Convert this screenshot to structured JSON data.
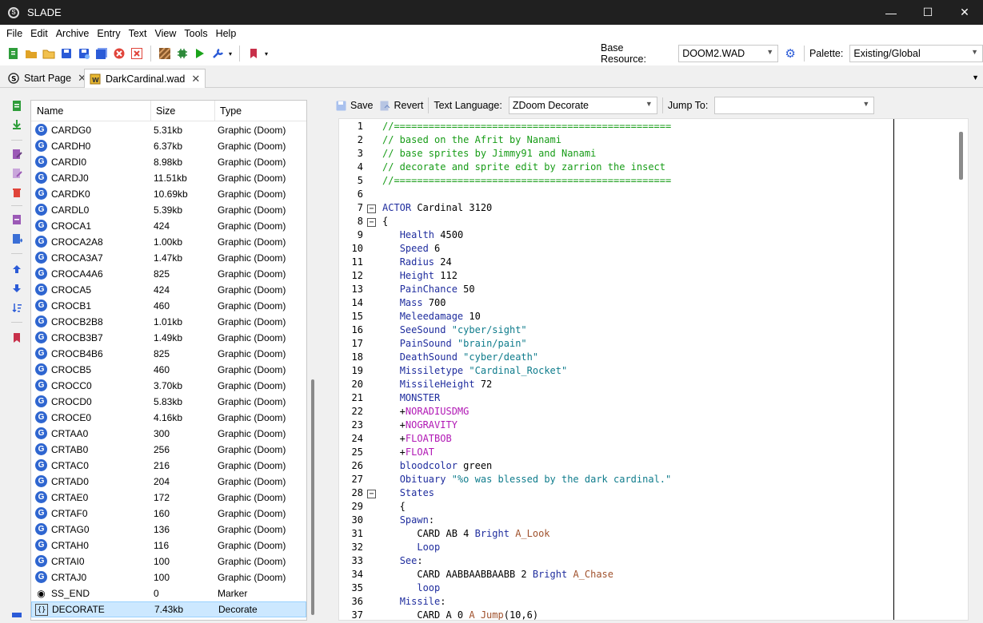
{
  "window": {
    "title": "SLADE",
    "minimize": "—",
    "maximize": "☐",
    "close": "✕"
  },
  "menu": [
    "File",
    "Edit",
    "Archive",
    "Entry",
    "Text",
    "View",
    "Tools",
    "Help"
  ],
  "toolbar": {
    "base_resource_label": "Base Resource:",
    "base_resource_value": "DOOM2.WAD",
    "palette_label": "Palette:",
    "palette_value": "Existing/Global"
  },
  "tabs": [
    {
      "label": "Start Page",
      "close": "✕"
    },
    {
      "label": "DarkCardinal.wad",
      "close": "✕"
    }
  ],
  "entry_list": {
    "columns": [
      "Name",
      "Size",
      "Type"
    ],
    "rows": [
      {
        "name": "CARDG0",
        "size": "5.31kb",
        "type": "Graphic (Doom)",
        "icon": "graphic-icon"
      },
      {
        "name": "CARDH0",
        "size": "6.37kb",
        "type": "Graphic (Doom)",
        "icon": "graphic-icon"
      },
      {
        "name": "CARDI0",
        "size": "8.98kb",
        "type": "Graphic (Doom)",
        "icon": "graphic-icon"
      },
      {
        "name": "CARDJ0",
        "size": "11.51kb",
        "type": "Graphic (Doom)",
        "icon": "graphic-icon"
      },
      {
        "name": "CARDK0",
        "size": "10.69kb",
        "type": "Graphic (Doom)",
        "icon": "graphic-icon"
      },
      {
        "name": "CARDL0",
        "size": "5.39kb",
        "type": "Graphic (Doom)",
        "icon": "graphic-icon"
      },
      {
        "name": "CROCA1",
        "size": "424",
        "type": "Graphic (Doom)",
        "icon": "graphic-icon"
      },
      {
        "name": "CROCA2A8",
        "size": "1.00kb",
        "type": "Graphic (Doom)",
        "icon": "graphic-icon"
      },
      {
        "name": "CROCA3A7",
        "size": "1.47kb",
        "type": "Graphic (Doom)",
        "icon": "graphic-icon"
      },
      {
        "name": "CROCA4A6",
        "size": "825",
        "type": "Graphic (Doom)",
        "icon": "graphic-icon"
      },
      {
        "name": "CROCA5",
        "size": "424",
        "type": "Graphic (Doom)",
        "icon": "graphic-icon"
      },
      {
        "name": "CROCB1",
        "size": "460",
        "type": "Graphic (Doom)",
        "icon": "graphic-icon"
      },
      {
        "name": "CROCB2B8",
        "size": "1.01kb",
        "type": "Graphic (Doom)",
        "icon": "graphic-icon"
      },
      {
        "name": "CROCB3B7",
        "size": "1.49kb",
        "type": "Graphic (Doom)",
        "icon": "graphic-icon"
      },
      {
        "name": "CROCB4B6",
        "size": "825",
        "type": "Graphic (Doom)",
        "icon": "graphic-icon"
      },
      {
        "name": "CROCB5",
        "size": "460",
        "type": "Graphic (Doom)",
        "icon": "graphic-icon"
      },
      {
        "name": "CROCC0",
        "size": "3.70kb",
        "type": "Graphic (Doom)",
        "icon": "graphic-icon"
      },
      {
        "name": "CROCD0",
        "size": "5.83kb",
        "type": "Graphic (Doom)",
        "icon": "graphic-icon"
      },
      {
        "name": "CROCE0",
        "size": "4.16kb",
        "type": "Graphic (Doom)",
        "icon": "graphic-icon"
      },
      {
        "name": "CRTAA0",
        "size": "300",
        "type": "Graphic (Doom)",
        "icon": "graphic-icon"
      },
      {
        "name": "CRTAB0",
        "size": "256",
        "type": "Graphic (Doom)",
        "icon": "graphic-icon"
      },
      {
        "name": "CRTAC0",
        "size": "216",
        "type": "Graphic (Doom)",
        "icon": "graphic-icon"
      },
      {
        "name": "CRTAD0",
        "size": "204",
        "type": "Graphic (Doom)",
        "icon": "graphic-icon"
      },
      {
        "name": "CRTAE0",
        "size": "172",
        "type": "Graphic (Doom)",
        "icon": "graphic-icon"
      },
      {
        "name": "CRTAF0",
        "size": "160",
        "type": "Graphic (Doom)",
        "icon": "graphic-icon"
      },
      {
        "name": "CRTAG0",
        "size": "136",
        "type": "Graphic (Doom)",
        "icon": "graphic-icon"
      },
      {
        "name": "CRTAH0",
        "size": "116",
        "type": "Graphic (Doom)",
        "icon": "graphic-icon"
      },
      {
        "name": "CRTAI0",
        "size": "100",
        "type": "Graphic (Doom)",
        "icon": "graphic-icon"
      },
      {
        "name": "CRTAJ0",
        "size": "100",
        "type": "Graphic (Doom)",
        "icon": "graphic-icon"
      },
      {
        "name": "SS_END",
        "size": "0",
        "type": "Marker",
        "icon": "marker-eye-icon"
      },
      {
        "name": "DECORATE",
        "size": "7.43kb",
        "type": "Decorate",
        "icon": "decorate-braces-icon",
        "selected": true
      }
    ]
  },
  "editor": {
    "save_label": "Save",
    "revert_label": "Revert",
    "text_language_label": "Text Language:",
    "text_language_value": "ZDoom Decorate",
    "jump_to_label": "Jump To:",
    "jump_to_value": "",
    "lines": [
      {
        "n": "1",
        "segs": [
          [
            "green",
            "//================================================"
          ]
        ]
      },
      {
        "n": "2",
        "segs": [
          [
            "green",
            "// based on the Afrit by Nanami"
          ]
        ]
      },
      {
        "n": "3",
        "segs": [
          [
            "green",
            "// base sprites by Jimmy91 and Nanami"
          ]
        ]
      },
      {
        "n": "4",
        "segs": [
          [
            "green",
            "// decorate and sprite edit by zarrion the insect"
          ]
        ]
      },
      {
        "n": "5",
        "segs": [
          [
            "green",
            "//================================================"
          ]
        ]
      },
      {
        "n": "6",
        "segs": []
      },
      {
        "n": "7",
        "fold": true,
        "segs": [
          [
            "kw",
            "ACTOR"
          ],
          [
            "plain",
            " Cardinal 3120"
          ]
        ]
      },
      {
        "n": "8",
        "fold": true,
        "segs": [
          [
            "plain",
            "{"
          ]
        ]
      },
      {
        "n": "9",
        "segs": [
          [
            "plain",
            "   "
          ],
          [
            "kw",
            "Health"
          ],
          [
            "plain",
            " 4500"
          ]
        ]
      },
      {
        "n": "10",
        "segs": [
          [
            "plain",
            "   "
          ],
          [
            "kw",
            "Speed"
          ],
          [
            "plain",
            " 6"
          ]
        ]
      },
      {
        "n": "11",
        "segs": [
          [
            "plain",
            "   "
          ],
          [
            "kw",
            "Radius"
          ],
          [
            "plain",
            " 24"
          ]
        ]
      },
      {
        "n": "12",
        "segs": [
          [
            "plain",
            "   "
          ],
          [
            "kw",
            "Height"
          ],
          [
            "plain",
            " 112"
          ]
        ]
      },
      {
        "n": "13",
        "segs": [
          [
            "plain",
            "   "
          ],
          [
            "kw",
            "PainChance"
          ],
          [
            "plain",
            " 50"
          ]
        ]
      },
      {
        "n": "14",
        "segs": [
          [
            "plain",
            "   "
          ],
          [
            "kw",
            "Mass"
          ],
          [
            "plain",
            " 700"
          ]
        ]
      },
      {
        "n": "15",
        "segs": [
          [
            "plain",
            "   "
          ],
          [
            "kw",
            "Meleedamage"
          ],
          [
            "plain",
            " 10"
          ]
        ]
      },
      {
        "n": "16",
        "segs": [
          [
            "plain",
            "   "
          ],
          [
            "kw",
            "SeeSound"
          ],
          [
            "plain",
            " "
          ],
          [
            "teal",
            "\"cyber/sight\""
          ]
        ]
      },
      {
        "n": "17",
        "segs": [
          [
            "plain",
            "   "
          ],
          [
            "kw",
            "PainSound"
          ],
          [
            "plain",
            " "
          ],
          [
            "teal",
            "\"brain/pain\""
          ]
        ]
      },
      {
        "n": "18",
        "segs": [
          [
            "plain",
            "   "
          ],
          [
            "kw",
            "DeathSound"
          ],
          [
            "plain",
            " "
          ],
          [
            "teal",
            "\"cyber/death\""
          ]
        ]
      },
      {
        "n": "19",
        "segs": [
          [
            "plain",
            "   "
          ],
          [
            "kw",
            "Missiletype"
          ],
          [
            "plain",
            " "
          ],
          [
            "teal",
            "\"Cardinal_Rocket\""
          ]
        ]
      },
      {
        "n": "20",
        "segs": [
          [
            "plain",
            "   "
          ],
          [
            "kw",
            "MissileHeight"
          ],
          [
            "plain",
            " 72"
          ]
        ]
      },
      {
        "n": "21",
        "segs": [
          [
            "plain",
            "   "
          ],
          [
            "kw",
            "MONSTER"
          ]
        ]
      },
      {
        "n": "22",
        "segs": [
          [
            "plain",
            "   +"
          ],
          [
            "mag",
            "NORADIUSDMG"
          ]
        ]
      },
      {
        "n": "23",
        "segs": [
          [
            "plain",
            "   +"
          ],
          [
            "mag",
            "NOGRAVITY"
          ]
        ]
      },
      {
        "n": "24",
        "segs": [
          [
            "plain",
            "   +"
          ],
          [
            "mag",
            "FLOATBOB"
          ]
        ]
      },
      {
        "n": "25",
        "segs": [
          [
            "plain",
            "   +"
          ],
          [
            "mag",
            "FLOAT"
          ]
        ]
      },
      {
        "n": "26",
        "segs": [
          [
            "plain",
            "   "
          ],
          [
            "kw",
            "bloodcolor"
          ],
          [
            "plain",
            " green"
          ]
        ]
      },
      {
        "n": "27",
        "segs": [
          [
            "plain",
            "   "
          ],
          [
            "kw",
            "Obituary"
          ],
          [
            "plain",
            " "
          ],
          [
            "teal",
            "\"%o was blessed by the dark cardinal.\""
          ]
        ]
      },
      {
        "n": "28",
        "fold": true,
        "segs": [
          [
            "plain",
            "   "
          ],
          [
            "kw",
            "States"
          ]
        ]
      },
      {
        "n": "29",
        "segs": [
          [
            "plain",
            "   {"
          ]
        ]
      },
      {
        "n": "30",
        "segs": [
          [
            "plain",
            "   "
          ],
          [
            "kw",
            "Spawn"
          ],
          [
            "plain",
            ":"
          ]
        ]
      },
      {
        "n": "31",
        "segs": [
          [
            "plain",
            "      CARD AB 4 "
          ],
          [
            "kw",
            "Bright"
          ],
          [
            "plain",
            " "
          ],
          [
            "brown",
            "A_Look"
          ]
        ]
      },
      {
        "n": "32",
        "segs": [
          [
            "plain",
            "      "
          ],
          [
            "kw",
            "Loop"
          ]
        ]
      },
      {
        "n": "33",
        "segs": [
          [
            "plain",
            "   "
          ],
          [
            "kw",
            "See"
          ],
          [
            "plain",
            ":"
          ]
        ]
      },
      {
        "n": "34",
        "segs": [
          [
            "plain",
            "      CARD AABBAABBAABB 2 "
          ],
          [
            "kw",
            "Bright"
          ],
          [
            "plain",
            " "
          ],
          [
            "brown",
            "A_Chase"
          ]
        ]
      },
      {
        "n": "35",
        "segs": [
          [
            "plain",
            "      "
          ],
          [
            "kw",
            "loop"
          ]
        ]
      },
      {
        "n": "36",
        "segs": [
          [
            "plain",
            "   "
          ],
          [
            "kw",
            "Missile"
          ],
          [
            "plain",
            ":"
          ]
        ]
      },
      {
        "n": "37",
        "segs": [
          [
            "plain",
            "      CARD A 0 "
          ],
          [
            "brown",
            "A_Jump"
          ],
          [
            "plain",
            "(10,6)"
          ]
        ]
      }
    ]
  },
  "colors": {
    "accent": "#2f66d0",
    "selection": "#cce8ff",
    "comment": "#179c17",
    "keyword": "#1f2d9e",
    "flag": "#b118b5",
    "string": "#0f7c8c",
    "function": "#a0522d"
  }
}
